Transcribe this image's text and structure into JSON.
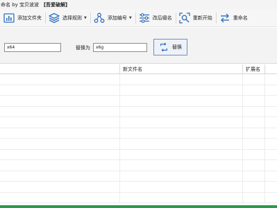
{
  "titlebar": {
    "title": "命名 by 宝贝波波",
    "badge": "【吾爱破解】"
  },
  "toolbar": {
    "add_folder": "添加文件夹",
    "select_rules": "选择规则",
    "add_number": "添加编号",
    "change_ext": "改后缀名",
    "restart": "重新开始",
    "rename": "重命名",
    "caret": "▼"
  },
  "replace_panel": {
    "find_value": "x64",
    "replace_label": "替换为",
    "replace_value": "x6g",
    "replace_button": "替换"
  },
  "table": {
    "columns": [
      "",
      "新文件名",
      "扩展名",
      ""
    ],
    "row_count": 12
  },
  "colors": {
    "accent_blue": "#2f6fc0",
    "statusbar_green": "#2b9a4a"
  },
  "icons": [
    "add-folder-icon",
    "layers-icon",
    "network-icon",
    "sliders-icon",
    "search-reset-icon",
    "swap-arrows-icon",
    "replace-icon"
  ]
}
